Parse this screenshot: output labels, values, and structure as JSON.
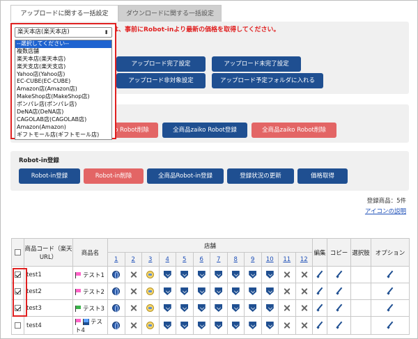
{
  "tabs": [
    {
      "label": "アップロードに関する一括設定",
      "active": true
    },
    {
      "label": "ダウンロードに関する一括設定",
      "active": false
    }
  ],
  "notice": "は、事前にRobot-inより最新の価格を取得してください。",
  "upload_buttons": [
    {
      "label": "アップロード完了設定",
      "color": "blue"
    },
    {
      "label": "アップロード未完了設定",
      "color": "blue"
    },
    {
      "label": "アップロード非対象設定",
      "color": "blue"
    },
    {
      "label": "アップロード予定フォルダに入れる",
      "color": "blue"
    }
  ],
  "zaiko_buttons": [
    {
      "label": "o Robot削除",
      "color": "red"
    },
    {
      "label": "全商品zaiko Robot登録",
      "color": "blue"
    },
    {
      "label": "全商品zaiko Robot削除",
      "color": "red"
    }
  ],
  "robotin": {
    "title": "Robot-in登録",
    "buttons": [
      {
        "label": "Robot-in登録",
        "color": "blue"
      },
      {
        "label": "Robot-in削除",
        "color": "red"
      },
      {
        "label": "全商品Robot-in登録",
        "color": "blue"
      },
      {
        "label": "登録状況の更新",
        "color": "blue"
      },
      {
        "label": "価格取得",
        "color": "blue"
      }
    ]
  },
  "count_text": "登録商品：5件",
  "icon_help": "アイコンの説明",
  "store_select": {
    "value": "楽天本店(楽天本店)",
    "options": [
      "--選択してください--",
      "複数店舗",
      "楽天本店(楽天本店)",
      "楽天支店(楽天支店)",
      "Yahoo店(Yahoo店)",
      "EC-CUBE(EC-CUBE)",
      "Amazon店(Amazon店)",
      "MakeShop店(MakeShop店)",
      "ポンパレ店(ポンパレ店)",
      "DeNA店(DeNA店)",
      "CAGOLAB店(CAGOLAB店)",
      "Amazon(Amazon)",
      "ギフトモール店(ギフトモール店)"
    ],
    "highlighted": 0
  },
  "table": {
    "header_code": "商品コード（楽天URL）",
    "header_name": "商品名",
    "header_store": "店舗",
    "store_numbers": [
      "1",
      "2",
      "3",
      "4",
      "5",
      "6",
      "7",
      "8",
      "9",
      "10",
      "11",
      "12"
    ],
    "header_edit": "編集",
    "header_copy": "コピー",
    "header_choice": "選択肢",
    "header_option": "オプション",
    "rows": [
      {
        "checked": true,
        "code": "test1",
        "flag": "pink",
        "name": "テスト1",
        "icons": [
          "globe",
          "x",
          "chat",
          "shield",
          "shield",
          "shield",
          "shield",
          "shield",
          "shield",
          "shield",
          "x",
          "x"
        ]
      },
      {
        "checked": true,
        "code": "test2",
        "flag": "pink",
        "name": "テスト2",
        "icons": [
          "globe",
          "x",
          "chat",
          "shield",
          "shield",
          "shield",
          "shield",
          "shield",
          "shield",
          "shield",
          "x",
          "x"
        ]
      },
      {
        "checked": true,
        "code": "test3",
        "flag": "green",
        "name": "テスト3",
        "icons": [
          "globe",
          "x",
          "chat",
          "shield",
          "shield",
          "shield",
          "shield",
          "shield",
          "shield",
          "shield",
          "x",
          "x"
        ]
      },
      {
        "checked": false,
        "code": "test4",
        "flag": "pinkblue",
        "name": "テスト4",
        "icons": [
          "globe",
          "x",
          "chat",
          "shield",
          "shield",
          "shield",
          "shield",
          "shield",
          "shield",
          "shield",
          "x",
          "x"
        ]
      }
    ]
  },
  "colors": {
    "accent": "#1f4f91",
    "danger": "#e36565",
    "highlight_red": "#e02020",
    "link": "#1d4fb8"
  }
}
